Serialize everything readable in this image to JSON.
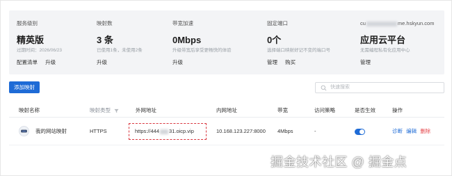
{
  "summary": {
    "service": {
      "label": "服务级别",
      "value": "精英版",
      "note": "过期时间：2026/06/23",
      "actions": [
        "配置清单",
        "升级"
      ]
    },
    "mappings": {
      "label": "映射数",
      "value": "3 条",
      "note": "已使用1条，未使用2条",
      "actions": [
        "升级"
      ]
    },
    "bandwidth": {
      "label": "带宽加速",
      "value": "0Mbps",
      "note": "升级带宽后享受更畅快的体验",
      "actions": [
        "升级"
      ]
    },
    "ports": {
      "label": "固定端口",
      "value": "0个",
      "note": "选择端口映射好记不变的端口号",
      "actions": [
        "管理",
        "购买"
      ]
    },
    "account": {
      "email_prefix": "cu",
      "email_suffix": "me.hskyun.com",
      "value": "应用云平台",
      "note": "无需编程私有化应用中心",
      "actions": [
        "管理"
      ]
    }
  },
  "toolbar": {
    "add_label": "添加映射",
    "search_placeholder": "快速搜索"
  },
  "table": {
    "headers": {
      "name": "映射名称",
      "type": "映射类型",
      "external": "外网地址",
      "internal": "内网地址",
      "bandwidth": "带宽",
      "policy": "访问策略",
      "enabled": "是否生效",
      "ops": "操作"
    },
    "rows": [
      {
        "name": "我的网站映射",
        "type": "HTTPS",
        "external_prefix": "https://444",
        "external_suffix": "31.oicp.vip",
        "internal": "10.168.123.227:8000",
        "bandwidth": "4Mbps",
        "policy": "-",
        "enabled": true,
        "ops": [
          "诊断",
          "编辑",
          "删除"
        ]
      }
    ]
  },
  "watermark": "掘金技术社区 @ 掘金点",
  "colors": {
    "accent": "#1e6bd6",
    "danger": "#e5484d",
    "panel": "#f3f4f6"
  }
}
